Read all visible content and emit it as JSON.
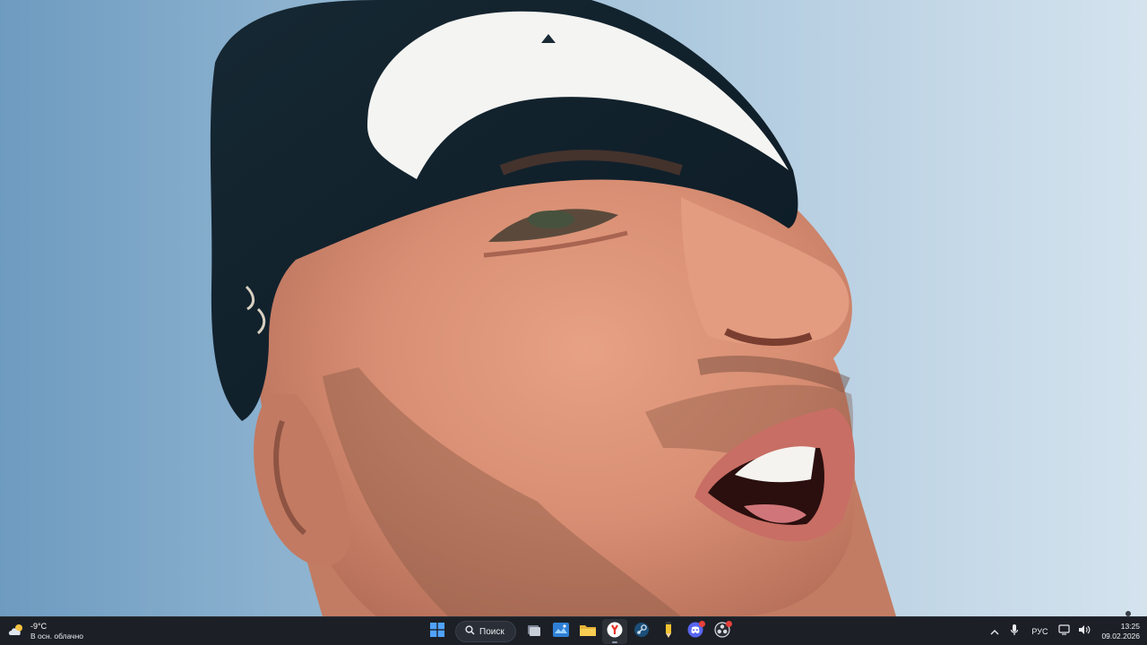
{
  "weather": {
    "temperature": "-9°C",
    "description": "В осн. облачно",
    "icon": "cloud-sun-icon"
  },
  "taskbar": {
    "search_label": "Поиск",
    "pinned": [
      {
        "name": "start-button",
        "icon": "windows-logo-icon"
      },
      {
        "name": "task-view-button",
        "icon": "task-view-icon"
      },
      {
        "name": "widgets-app-button",
        "icon": "widgets-icon"
      },
      {
        "name": "file-explorer-button",
        "icon": "folder-icon"
      },
      {
        "name": "yandex-browser-button",
        "icon": "yandex-icon",
        "active": true
      },
      {
        "name": "steam-button",
        "icon": "steam-icon"
      },
      {
        "name": "pencil-app-button",
        "icon": "pencil-icon"
      },
      {
        "name": "discord-button",
        "icon": "discord-icon",
        "badge": true
      },
      {
        "name": "obs-button",
        "icon": "obs-icon",
        "badge": true
      }
    ]
  },
  "tray": {
    "language": "РУС",
    "time": "13:25",
    "date": "09.02.2026"
  },
  "colors": {
    "taskbar_bg": "#1c2026",
    "sky_left": "#6e9bc0",
    "sky_right": "#d4e3ee",
    "accent": "#4fa3ff"
  }
}
